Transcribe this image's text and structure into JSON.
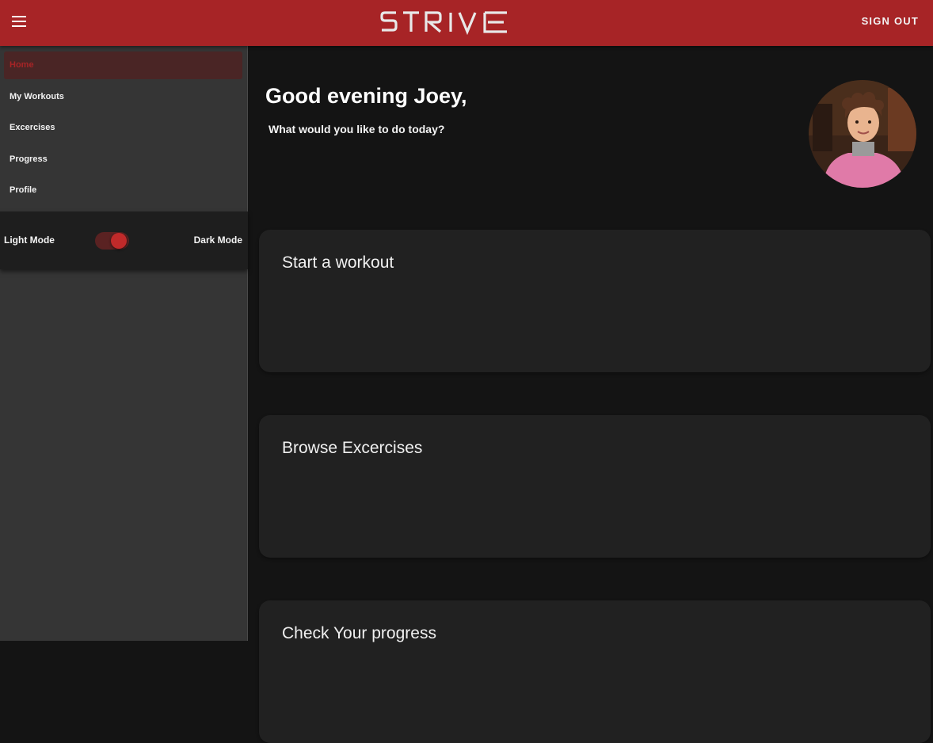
{
  "header": {
    "menu_icon": "hamburger-menu-icon",
    "logo_text": "STRIVE",
    "sign_out_label": "SIGN OUT",
    "accent_color": "#a72426"
  },
  "sidebar": {
    "items": [
      {
        "label": "Home",
        "active": true
      },
      {
        "label": "My Workouts",
        "active": false
      },
      {
        "label": "Excercises",
        "active": false
      },
      {
        "label": "Progress",
        "active": false
      },
      {
        "label": "Profile",
        "active": false
      }
    ],
    "theme_toggle": {
      "light_label": "Light Mode",
      "dark_label": "Dark Mode",
      "dark_mode_on": true
    }
  },
  "main": {
    "greeting": "Good evening Joey,",
    "subtitle": "What would you like to do today?",
    "cards": [
      {
        "title": "Start a workout"
      },
      {
        "title": "Browse Excercises"
      },
      {
        "title": "Check Your progress"
      }
    ]
  }
}
